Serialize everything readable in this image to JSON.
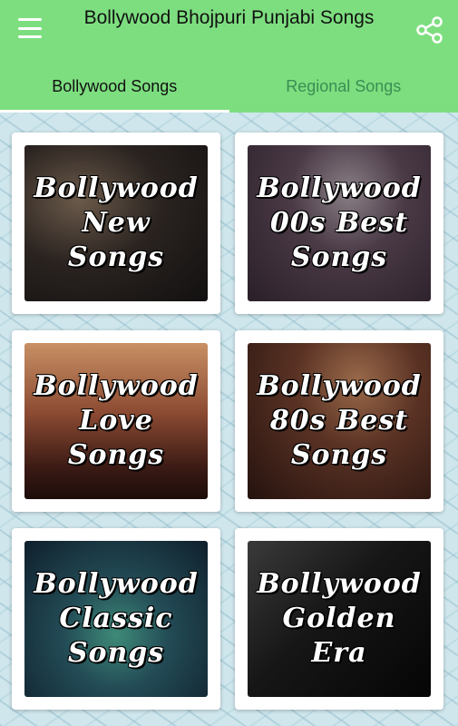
{
  "app": {
    "title": "Bollywood Bhojpuri Punjabi Songs",
    "accent_color": "#7dde7f",
    "menu_icon": "hamburger-menu-icon",
    "share_icon": "share-icon"
  },
  "tabs": [
    {
      "label": "Bollywood Songs",
      "active": true
    },
    {
      "label": "Regional Songs",
      "active": false
    }
  ],
  "cards": [
    {
      "label": "Bollywood\nNew\nSongs"
    },
    {
      "label": "Bollywood\n00s Best\nSongs"
    },
    {
      "label": "Bollywood\nLove\nSongs"
    },
    {
      "label": "Bollywood\n80s Best\nSongs"
    },
    {
      "label": "Bollywood\nClassic\nSongs"
    },
    {
      "label": "Bollywood\nGolden\nEra"
    }
  ]
}
